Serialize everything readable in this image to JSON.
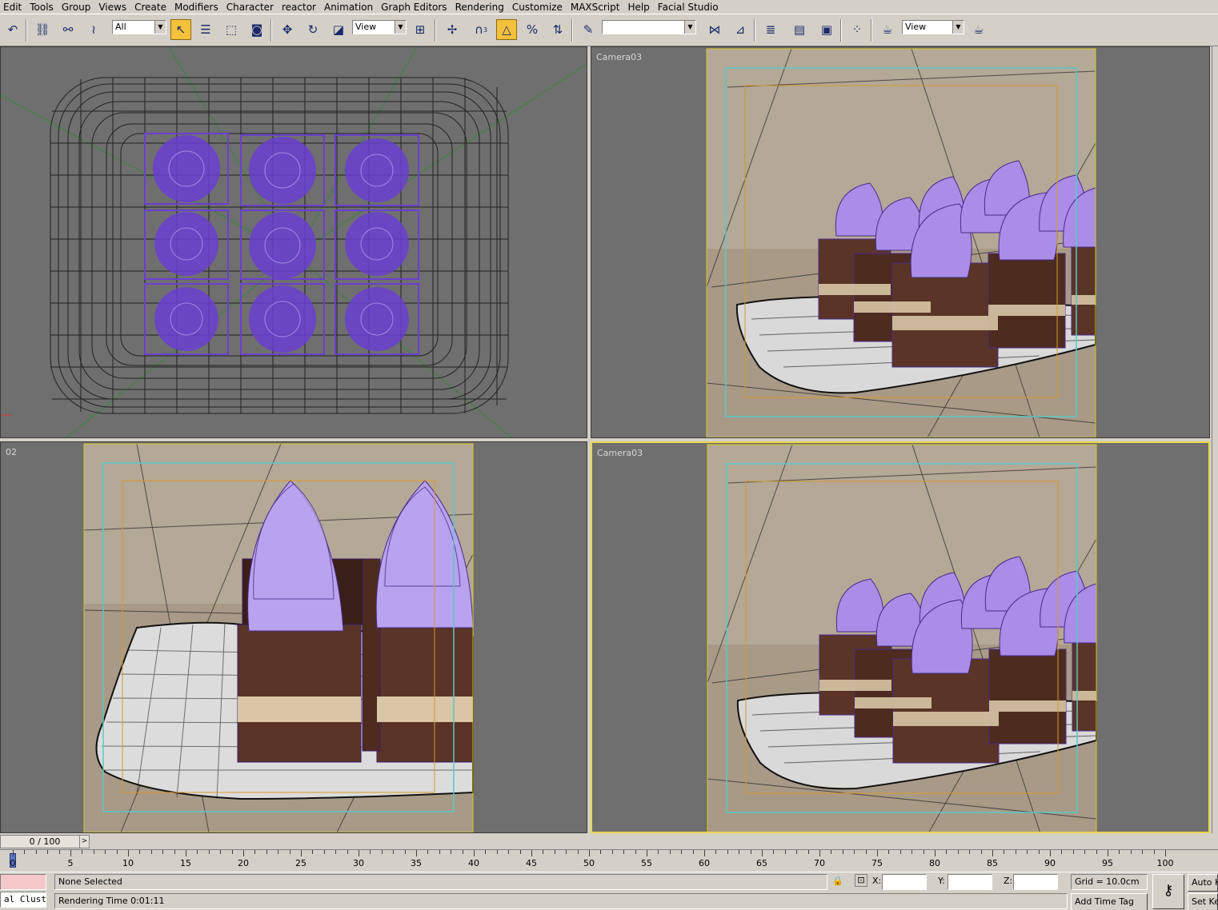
{
  "menu": [
    "Edit",
    "Tools",
    "Group",
    "Views",
    "Create",
    "Modifiers",
    "Character",
    "reactor",
    "Animation",
    "Graph Editors",
    "Rendering",
    "Customize",
    "MAXScript",
    "Help",
    "Facial Studio"
  ],
  "toolbar": {
    "selection_filter": "All",
    "ref_coord": "View",
    "named_sel": "",
    "render_view": "View",
    "snap_label": "3"
  },
  "viewports": {
    "top": {
      "label": ""
    },
    "camera_top_right": {
      "label": "Camera03"
    },
    "camera_bottom_left": {
      "label": "02"
    },
    "camera_bottom_right": {
      "label": "Camera03"
    }
  },
  "timeline": {
    "frame_display": "0 / 100",
    "ticks": [
      "0",
      "5",
      "10",
      "15",
      "20",
      "25",
      "30",
      "35",
      "40",
      "45",
      "50",
      "55",
      "60",
      "65",
      "70",
      "75",
      "80",
      "85",
      "90",
      "95",
      "100"
    ]
  },
  "status": {
    "script_listener": "al Clust",
    "selection": "None Selected",
    "prompt": "Rendering Time  0:01:11",
    "x_label": "X:",
    "y_label": "Y:",
    "z_label": "Z:",
    "x_value": "",
    "y_value": "",
    "z_value": "",
    "grid": "Grid = 10.0cm",
    "add_time_tag": "Add Time Tag",
    "auto_key": "Auto Ke",
    "set_key": "Set Ke"
  },
  "colors": {
    "ui_gray": "#d4d0c8",
    "viewport_gray": "#6f6f6f",
    "active_border": "#e8d84a",
    "wire_purple": "#6a3fd1",
    "safe_frame_cyan": "#5bc8c8",
    "safe_frame_orange": "#d89a2a"
  }
}
